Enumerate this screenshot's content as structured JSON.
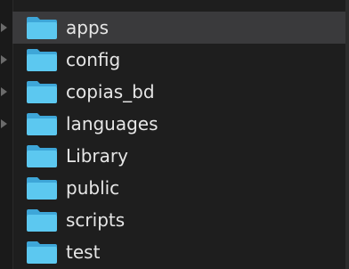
{
  "sidebar": {
    "items": [
      {
        "label": "apps",
        "icon": "folder-icon",
        "selected": true,
        "has_disclosure": true
      },
      {
        "label": "config",
        "icon": "folder-icon",
        "selected": false,
        "has_disclosure": true
      },
      {
        "label": "copias_bd",
        "icon": "folder-icon",
        "selected": false,
        "has_disclosure": true
      },
      {
        "label": "languages",
        "icon": "folder-icon",
        "selected": false,
        "has_disclosure": true
      },
      {
        "label": "Library",
        "icon": "folder-icon",
        "selected": false,
        "has_disclosure": false
      },
      {
        "label": "public",
        "icon": "folder-icon",
        "selected": false,
        "has_disclosure": false
      },
      {
        "label": "scripts",
        "icon": "folder-icon",
        "selected": false,
        "has_disclosure": false
      },
      {
        "label": "test",
        "icon": "folder-icon",
        "selected": false,
        "has_disclosure": false
      }
    ]
  },
  "colors": {
    "background": "#1e1e1e",
    "selection": "#3a3a3c",
    "folder_front": "#5cc8f0",
    "folder_back": "#3ea6d8",
    "text": "#e6e6e6"
  }
}
